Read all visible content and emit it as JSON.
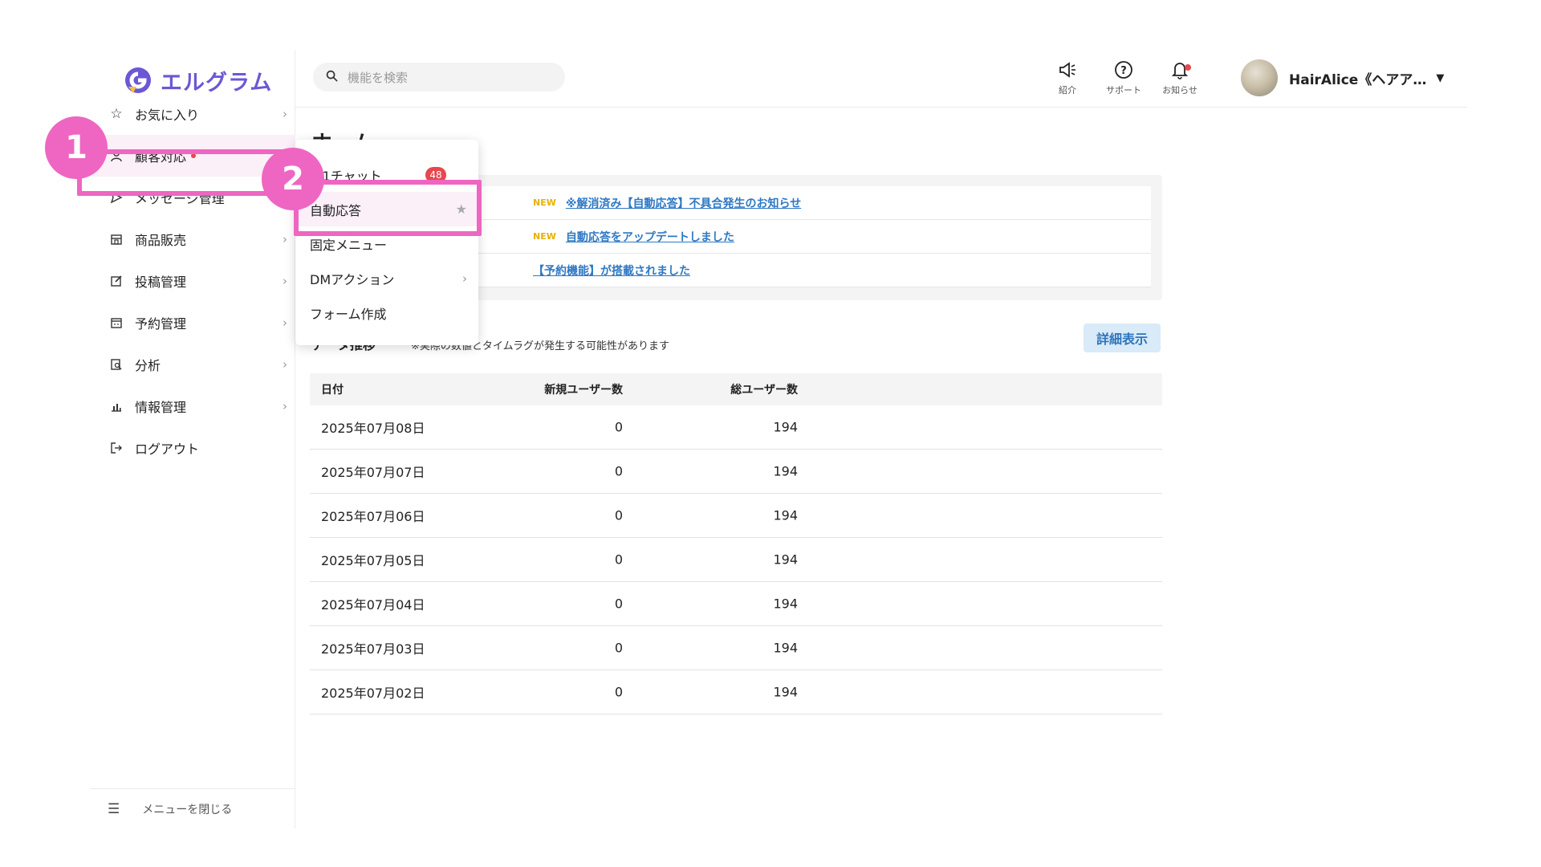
{
  "app": {
    "logo_text": "エルグラム",
    "brand_color": "#6c57d6"
  },
  "sidebar": {
    "items": [
      {
        "label": "お気に入り",
        "icon": "star-outline-icon"
      },
      {
        "label": "顧客対応",
        "icon": "user-icon",
        "active": true,
        "has_dot": true
      },
      {
        "label": "メッセージ管理",
        "icon": "send-icon"
      },
      {
        "label": "商品販売",
        "icon": "shop-icon"
      },
      {
        "label": "投稿管理",
        "icon": "edit-icon"
      },
      {
        "label": "予約管理",
        "icon": "calendar-icon"
      },
      {
        "label": "分析",
        "icon": "analytics-icon"
      },
      {
        "label": "情報管理",
        "icon": "bar-chart-icon"
      },
      {
        "label": "ログアウト",
        "icon": "logout-icon"
      }
    ],
    "footer_label": "メニューを閉じる"
  },
  "topbar": {
    "search_placeholder": "機能を検索",
    "intro_label": "紹介",
    "support_label": "サポート",
    "notice_label": "お知らせ",
    "account_name": "HairAlice《ヘアア…"
  },
  "main": {
    "page_title": "ホーム",
    "news": [
      {
        "badge": "NEW",
        "text": "※解消済み【自動応答】不具合発生のお知らせ"
      },
      {
        "badge": "NEW",
        "text": "自動応答をアップデートしました"
      },
      {
        "badge": "",
        "text": "【予約機能】が搭載されました"
      }
    ],
    "section_title": "データ推移",
    "section_note": "※実際の数値とタイムラグが発生する可能性があります",
    "detail_button": "詳細表示",
    "table": {
      "headers": [
        "日付",
        "新規ユーザー数",
        "総ユーザー数"
      ],
      "rows": [
        [
          "2025年07月08日",
          "0",
          "194"
        ],
        [
          "2025年07月07日",
          "0",
          "194"
        ],
        [
          "2025年07月06日",
          "0",
          "194"
        ],
        [
          "2025年07月05日",
          "0",
          "194"
        ],
        [
          "2025年07月04日",
          "0",
          "194"
        ],
        [
          "2025年07月03日",
          "0",
          "194"
        ],
        [
          "2025年07月02日",
          "0",
          "194"
        ]
      ]
    }
  },
  "dropdown": {
    "items": [
      {
        "label": "1:1チャット",
        "badge": "48"
      },
      {
        "label": "自動応答",
        "highlighted": true
      },
      {
        "label": "固定メニュー"
      },
      {
        "label": "DMアクション",
        "has_submenu": true
      },
      {
        "label": "フォーム作成"
      }
    ]
  },
  "tutorial": {
    "step1": "1",
    "step2": "2",
    "highlight_color": "#ee66c2"
  }
}
